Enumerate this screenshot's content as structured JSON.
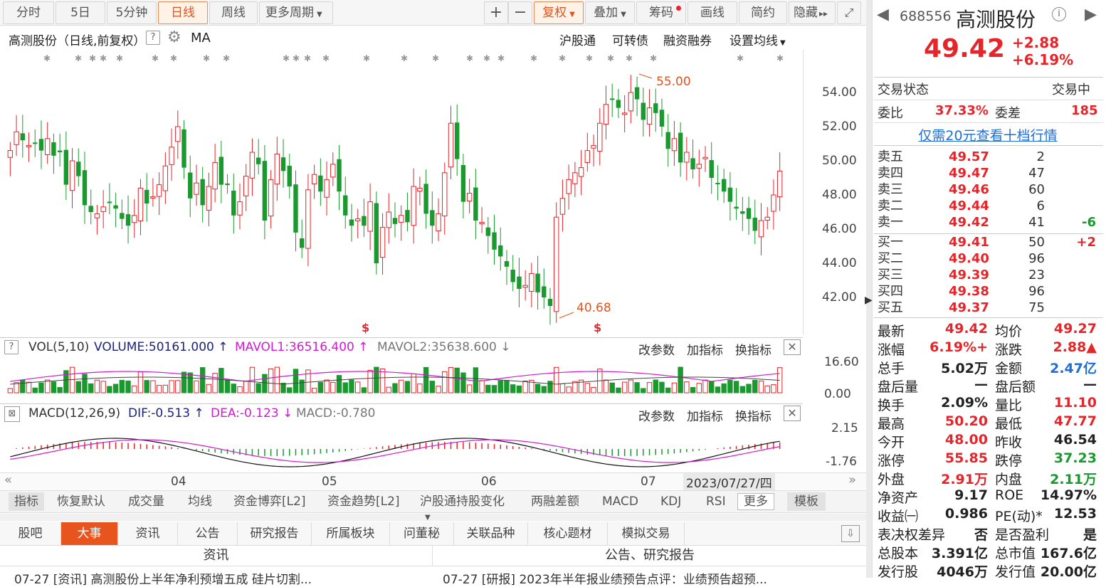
{
  "toolbar": {
    "periods": [
      "分时",
      "5日",
      "5分钟",
      "日线",
      "周线",
      "更多周期"
    ],
    "active_period": "日线",
    "plus": "+",
    "minus": "−",
    "fuquan": "复权",
    "overlay": "叠加",
    "chips": "筹码",
    "draw": "画线",
    "simple": "简约",
    "hide": "隐藏"
  },
  "chart_header": {
    "title": "高测股份（日线,前复权）",
    "help": "?",
    "ma": "MA",
    "links": [
      "沪股通",
      "可转债",
      "融资融券",
      "设置均线"
    ]
  },
  "price_axis": [
    "54.00",
    "52.00",
    "50.00",
    "48.00",
    "46.00",
    "44.00",
    "42.00"
  ],
  "annotations": {
    "high": "55.00",
    "low": "40.68"
  },
  "vol_panel": {
    "help": "?",
    "label": "VOL(5,10)",
    "volume": "VOLUME:50161.000",
    "mavol1": "MAVOL1:36516.400",
    "mavol2": "MAVOL2:35638.600",
    "actions": [
      "改参数",
      "加指标",
      "换指标"
    ],
    "axis": [
      "16.60",
      "0.00"
    ]
  },
  "macd_panel": {
    "label": "MACD(12,26,9)",
    "dif": "DIF:-0.513",
    "dea": "DEA:-0.123",
    "macd": "MACD:-0.780",
    "actions": [
      "改参数",
      "加指标",
      "换指标"
    ],
    "axis": [
      "2.15",
      "-1.76"
    ]
  },
  "date_axis": {
    "months": [
      "04",
      "05",
      "06",
      "07"
    ],
    "current": "2023/07/27/四"
  },
  "indicator_tabs": [
    "指标",
    "恢复默认",
    "成交量",
    "均线",
    "资金博弈[L2]",
    "资金趋势[L2]",
    "沪股通持股变化",
    "两融差额",
    "MACD",
    "KDJ",
    "RSI",
    "更多",
    "模板"
  ],
  "news_tabs": [
    "股吧",
    "大事",
    "资讯",
    "公告",
    "研究报告",
    "所属板块",
    "问董秘",
    "关联品种",
    "核心题材",
    "模拟交易"
  ],
  "news_active": "大事",
  "news_headers": [
    "资讯",
    "公告、研究报告"
  ],
  "news_rows": [
    "07-27 [资讯] 高测股份上半年净利预增五成 硅片切割...",
    "07-27 [研报] 2023年半年报业绩预告点评：业绩预告超预..."
  ],
  "quote": {
    "code": "688556",
    "name": "高测股份",
    "price": "49.42",
    "change": "+2.88",
    "pct": "+6.19%",
    "status_label": "交易状态",
    "status": "交易中",
    "weibi_label": "委比",
    "weibi": "37.33%",
    "weicha_label": "委差",
    "weicha": "185",
    "promo": "仅需20元查看十档行情"
  },
  "sells": [
    {
      "label": "卖五",
      "price": "49.57",
      "vol": "2",
      "delta": ""
    },
    {
      "label": "卖四",
      "price": "49.47",
      "vol": "47",
      "delta": ""
    },
    {
      "label": "卖三",
      "price": "49.46",
      "vol": "60",
      "delta": ""
    },
    {
      "label": "卖二",
      "price": "49.44",
      "vol": "6",
      "delta": ""
    },
    {
      "label": "卖一",
      "price": "49.42",
      "vol": "41",
      "delta": "-6"
    }
  ],
  "buys": [
    {
      "label": "买一",
      "price": "49.41",
      "vol": "50",
      "delta": "+2"
    },
    {
      "label": "买二",
      "price": "49.40",
      "vol": "96",
      "delta": ""
    },
    {
      "label": "买三",
      "price": "49.39",
      "vol": "23",
      "delta": ""
    },
    {
      "label": "买四",
      "price": "49.38",
      "vol": "96",
      "delta": ""
    },
    {
      "label": "买五",
      "price": "49.37",
      "vol": "75",
      "delta": ""
    }
  ],
  "stats": [
    {
      "l1": "最新",
      "v1": "49.42",
      "c1": "red",
      "l2": "均价",
      "v2": "49.27",
      "c2": "red"
    },
    {
      "l1": "涨幅",
      "v1": "+6.19%",
      "c1": "red",
      "l2": "涨跌",
      "v2": "▲2.88",
      "c2": "red"
    },
    {
      "l1": "总手",
      "v1": "5.02万",
      "c1": "dark",
      "l2": "金额",
      "v2": "2.47亿",
      "c2": "blue"
    },
    {
      "l1": "盘后量",
      "v1": "—",
      "c1": "dark",
      "l2": "盘后额",
      "v2": "—",
      "c2": "dark"
    },
    {
      "l1": "换手",
      "v1": "2.09%",
      "c1": "dark",
      "l2": "量比",
      "v2": "11.10",
      "c2": "red"
    },
    {
      "l1": "最高",
      "v1": "50.20",
      "c1": "red",
      "l2": "最低",
      "v2": "47.77",
      "c2": "red"
    },
    {
      "l1": "今开",
      "v1": "48.00",
      "c1": "red",
      "l2": "昨收",
      "v2": "46.54",
      "c2": "dark"
    },
    {
      "l1": "涨停",
      "v1": "55.85",
      "c1": "red",
      "l2": "跌停",
      "v2": "37.23",
      "c2": "green"
    },
    {
      "l1": "外盘",
      "v1": "2.91万",
      "c1": "red",
      "l2": "内盘",
      "v2": "2.11万",
      "c2": "green"
    },
    {
      "l1": "净资产",
      "v1": "9.17",
      "c1": "dark",
      "l2": "ROE",
      "v2": "14.97%",
      "c2": "dark"
    },
    {
      "l1": "收益㈠",
      "v1": "0.986",
      "c1": "dark",
      "l2": "PE(动)*",
      "v2": "12.53",
      "c2": "dark"
    },
    {
      "l1": "表决权差异",
      "v1": "否",
      "c1": "dark",
      "l2": "是否盈利",
      "v2": "是",
      "c2": "dark"
    },
    {
      "l1": "总股本",
      "v1": "3.391亿",
      "c1": "dark",
      "l2": "总市值",
      "v2": "167.6亿",
      "c2": "dark"
    },
    {
      "l1": "发行股",
      "v1": "4046万",
      "c1": "dark",
      "l2": "发行值",
      "v2": "20.00亿",
      "c2": "dark"
    }
  ],
  "colors": {
    "up": "#e5252a",
    "down": "#1a9a2e",
    "accent": "#e0541f",
    "blue": "#1f6fd6"
  }
}
